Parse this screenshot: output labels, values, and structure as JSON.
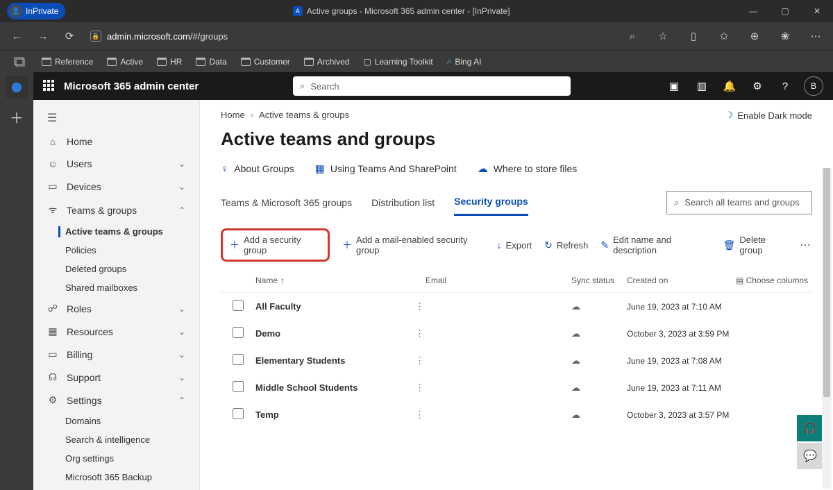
{
  "window": {
    "inprivate_label": "InPrivate",
    "title": "Active groups - Microsoft 365 admin center - [InPrivate]"
  },
  "url": {
    "host": "admin.microsoft.com",
    "path": "/#/groups"
  },
  "bookmarks": [
    "Reference",
    "Active",
    "HR",
    "Data",
    "Customer",
    "Archived",
    "Learning Toolkit",
    "Bing AI"
  ],
  "m365": {
    "title": "Microsoft 365 admin center",
    "search_placeholder": "Search",
    "avatar": "B"
  },
  "sidebar": {
    "home": "Home",
    "users": "Users",
    "devices": "Devices",
    "teams": "Teams & groups",
    "teams_children": [
      "Active teams & groups",
      "Policies",
      "Deleted groups",
      "Shared mailboxes"
    ],
    "roles": "Roles",
    "resources": "Resources",
    "billing": "Billing",
    "support": "Support",
    "settings": "Settings",
    "settings_children": [
      "Domains",
      "Search & intelligence",
      "Org settings",
      "Microsoft 365 Backup"
    ]
  },
  "breadcrumb": {
    "home": "Home",
    "current": "Active teams & groups"
  },
  "dark_mode": "Enable Dark mode",
  "page_title": "Active teams and groups",
  "learn": {
    "about": "About Groups",
    "teams_sp": "Using Teams And SharePoint",
    "store": "Where to store files"
  },
  "tabs": {
    "t1": "Teams & Microsoft 365 groups",
    "t2": "Distribution list",
    "t3": "Security groups",
    "search": "Search all teams and groups"
  },
  "commands": {
    "add": "Add a security group",
    "add_mail": "Add a mail-enabled security group",
    "export": "Export",
    "refresh": "Refresh",
    "edit": "Edit name and description",
    "delete": "Delete group"
  },
  "cols": {
    "name": "Name",
    "email": "Email",
    "sync": "Sync status",
    "created": "Created on",
    "choose": "Choose columns"
  },
  "rows": [
    {
      "name": "All Faculty",
      "created": "June 19, 2023 at 7:10 AM"
    },
    {
      "name": "Demo",
      "created": "October 3, 2023 at 3:59 PM"
    },
    {
      "name": "Elementary Students",
      "created": "June 19, 2023 at 7:08 AM"
    },
    {
      "name": "Middle School Students",
      "created": "June 19, 2023 at 7:11 AM"
    },
    {
      "name": "Temp",
      "created": "October 3, 2023 at 3:57 PM"
    }
  ]
}
